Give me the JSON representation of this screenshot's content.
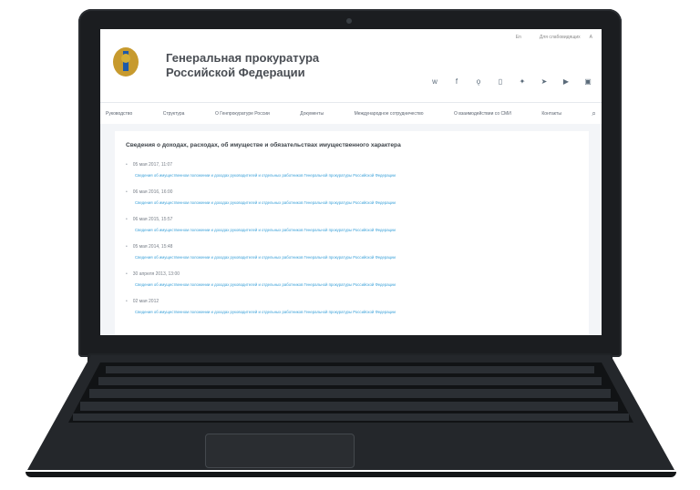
{
  "site": {
    "title_line1": "Генеральная прокуратура",
    "title_line2": "Российской Федерации",
    "util": [
      "En",
      "",
      "Для слабовидящих",
      "А"
    ],
    "social_icons": [
      "vk-icon",
      "facebook-icon",
      "odnoklassniki-icon",
      "instagram-icon",
      "twitter-icon",
      "telegram-icon",
      "youtube-icon",
      "mail-icon"
    ]
  },
  "nav": {
    "items": [
      "Руководство",
      "Структура",
      "О Генпрокуратуре России",
      "Документы",
      "Международное сотрудничество",
      "О взаимодействии со СМИ",
      "Контакты"
    ],
    "search_icon": "search-icon"
  },
  "content": {
    "heading": "Сведения о доходах, расходах, об имуществе и обязательствах имущественного характера",
    "entries": [
      {
        "date": "05 мая 2017, 11:07",
        "link": "Сведения об имущественном положении и доходах руководителей и отдельных работников Генеральной прокуратуры Российской Федерации"
      },
      {
        "date": "06 мая 2016, 16:00",
        "link": "Сведения об имущественном положении и доходах руководителей и отдельных работников Генеральной прокуратуры Российской Федерации"
      },
      {
        "date": "06 мая 2015, 15:57",
        "link": "Сведения об имущественном положении и доходах руководителей и отдельных работников Генеральной прокуратуры Российской Федерации"
      },
      {
        "date": "05 мая 2014, 15:48",
        "link": "Сведения об имущественном положении и доходах руководителей и отдельных работников Генеральной прокуратуры Российской Федерации"
      },
      {
        "date": "30 апреля 2013, 13:00",
        "link": "Сведения об имущественном положении и доходах руководителей и отдельных работников Генеральной прокуратуры Российской Федерации"
      },
      {
        "date": "02 мая 2012",
        "link": "Сведения об имущественном положении и доходах руководителей и отдельных работников Генеральной прокуратуры Российской Федерации"
      }
    ]
  },
  "colors": {
    "link": "#3aa1d9",
    "laptop": "#1b1d20"
  }
}
